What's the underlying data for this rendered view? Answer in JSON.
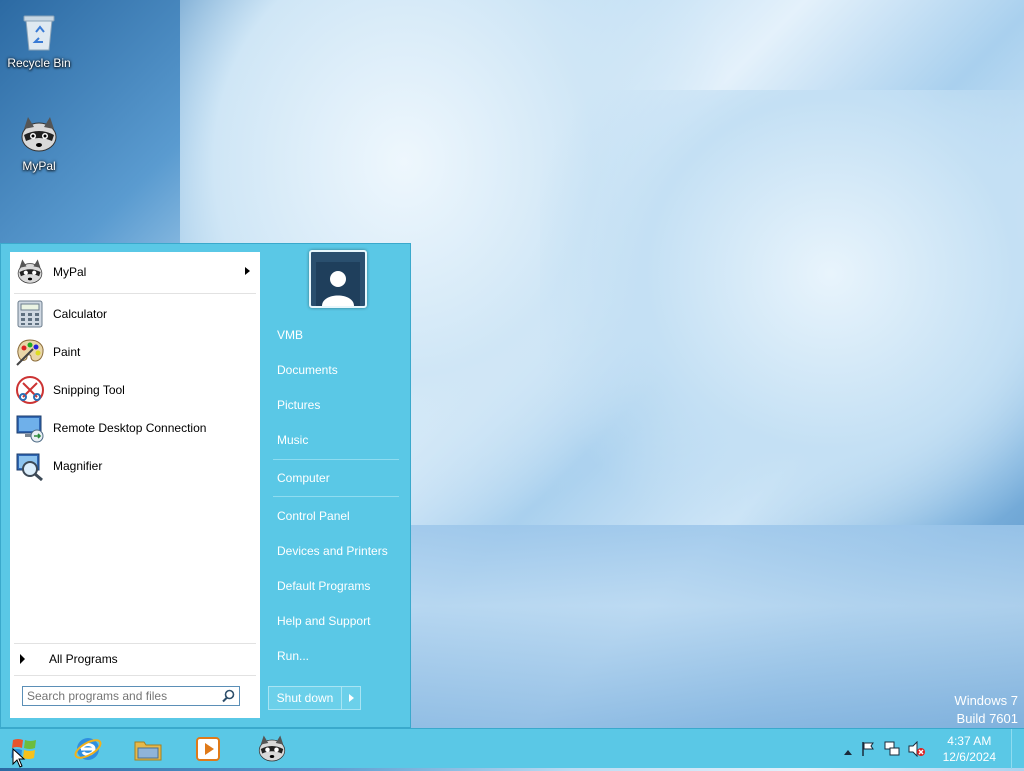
{
  "desktop": {
    "icons": [
      {
        "label": "Recycle Bin",
        "icon": "recycle-bin-icon"
      },
      {
        "label": "MyPal",
        "icon": "raccoon-icon"
      }
    ],
    "watermark": {
      "line1": "Windows 7",
      "line2": "Build 7601"
    }
  },
  "start_menu": {
    "programs": [
      {
        "label": "MyPal",
        "icon": "raccoon-icon",
        "has_submenu": true
      },
      {
        "label": "Calculator",
        "icon": "calculator-icon"
      },
      {
        "label": "Paint",
        "icon": "paint-palette-icon"
      },
      {
        "label": "Snipping Tool",
        "icon": "scissors-icon"
      },
      {
        "label": "Remote Desktop Connection",
        "icon": "remote-desktop-icon"
      },
      {
        "label": "Magnifier",
        "icon": "magnifier-icon"
      }
    ],
    "all_programs": "All Programs",
    "search": {
      "placeholder": "Search programs and files",
      "value": ""
    },
    "user_name": "VMB",
    "right_links": {
      "documents": "Documents",
      "pictures": "Pictures",
      "music": "Music",
      "computer": "Computer",
      "control_panel": "Control Panel",
      "devices_printers": "Devices and Printers",
      "default_programs": "Default Programs",
      "help_support": "Help and Support",
      "run": "Run..."
    },
    "shutdown_label": "Shut down"
  },
  "taskbar": {
    "pinned": [
      "start-orb-icon",
      "internet-explorer-icon",
      "file-explorer-icon",
      "media-player-icon",
      "raccoon-icon"
    ],
    "clock": {
      "time": "4:37 AM",
      "date": "12/6/2024"
    }
  },
  "colors": {
    "start_menu_bg": "#5ac8e6",
    "taskbar_bg": "#5ac8e6",
    "left_pane_bg": "#ffffff"
  }
}
